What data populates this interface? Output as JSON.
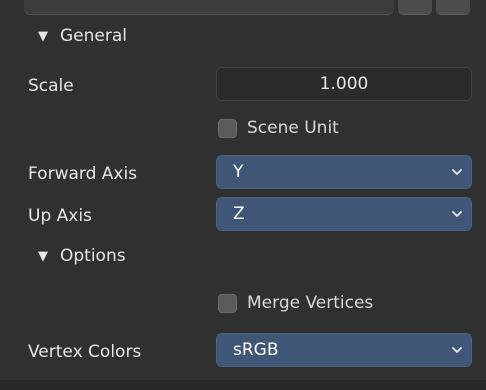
{
  "sections": {
    "general": {
      "label": "General"
    },
    "options": {
      "label": "Options"
    }
  },
  "scale": {
    "label": "Scale",
    "value": "1.000"
  },
  "scene_unit": {
    "label": "Scene Unit",
    "checked": false
  },
  "forward_axis": {
    "label": "Forward Axis",
    "value": "Y"
  },
  "up_axis": {
    "label": "Up Axis",
    "value": "Z"
  },
  "merge_vertices": {
    "label": "Merge Vertices",
    "checked": false
  },
  "vertex_colors": {
    "label": "Vertex Colors",
    "value": "sRGB"
  },
  "colors": {
    "panel_bg": "#303030",
    "dropdown_bg": "#3f5676",
    "field_bg": "#2b2b2b",
    "checkbox_bg": "#5a5a5a"
  },
  "icons": {
    "section_toggle": "triangle-down-icon",
    "dropdown": "chevron-down-icon"
  }
}
